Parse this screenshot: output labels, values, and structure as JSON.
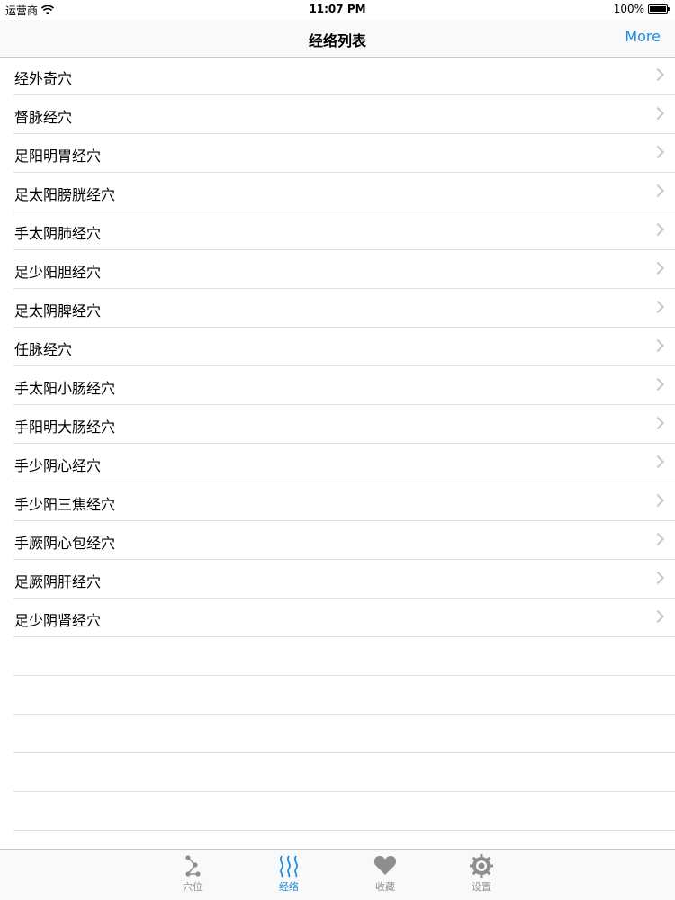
{
  "status": {
    "carrier": "运营商",
    "time": "11:07 PM",
    "battery": "100%"
  },
  "nav": {
    "title": "经络列表",
    "more": "More"
  },
  "items": [
    {
      "label": "经外奇穴"
    },
    {
      "label": "督脉经穴"
    },
    {
      "label": "足阳明胃经穴"
    },
    {
      "label": "足太阳膀胱经穴"
    },
    {
      "label": "手太阴肺经穴"
    },
    {
      "label": "足少阳胆经穴"
    },
    {
      "label": "足太阴脾经穴"
    },
    {
      "label": "任脉经穴"
    },
    {
      "label": "手太阳小肠经穴"
    },
    {
      "label": "手阳明大肠经穴"
    },
    {
      "label": "手少阴心经穴"
    },
    {
      "label": "手少阳三焦经穴"
    },
    {
      "label": "手厥阴心包经穴"
    },
    {
      "label": "足厥阴肝经穴"
    },
    {
      "label": "足少阴肾经穴"
    }
  ],
  "tabs": [
    {
      "label": "穴位",
      "icon": "acupoint-icon"
    },
    {
      "label": "经络",
      "icon": "meridian-icon",
      "active": true
    },
    {
      "label": "收藏",
      "icon": "heart-icon"
    },
    {
      "label": "设置",
      "icon": "gear-icon"
    }
  ],
  "colors": {
    "accent": "#1a8ee1",
    "inactive": "#929292"
  }
}
